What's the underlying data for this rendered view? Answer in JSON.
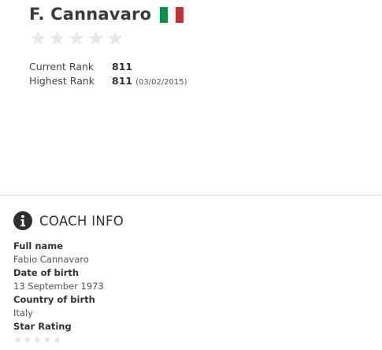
{
  "coach": {
    "name": "F. Cannavaro",
    "flag_icon": "italy-flag-icon",
    "flag_colors": [
      "#009246",
      "#ffffff",
      "#ce2b37"
    ],
    "star_rating": 0,
    "star_max": 5,
    "star_icon": "star-icon",
    "star_empty_color": "#e8e8e8"
  },
  "ranks": {
    "current_label": "Current Rank",
    "current_value": "811",
    "highest_label": "Highest Rank",
    "highest_value": "811",
    "highest_date": "(03/02/2015)"
  },
  "coach_info": {
    "icon": "info-icon",
    "title": "COACH INFO",
    "fields": [
      {
        "label": "Full name",
        "value": "Fabio Cannavaro"
      },
      {
        "label": "Date of birth",
        "value": "13 September 1973"
      },
      {
        "label": "Country of birth",
        "value": "Italy"
      }
    ],
    "star_rating_label": "Star Rating",
    "star_rating_value": 0,
    "star_rating_max": 5
  }
}
